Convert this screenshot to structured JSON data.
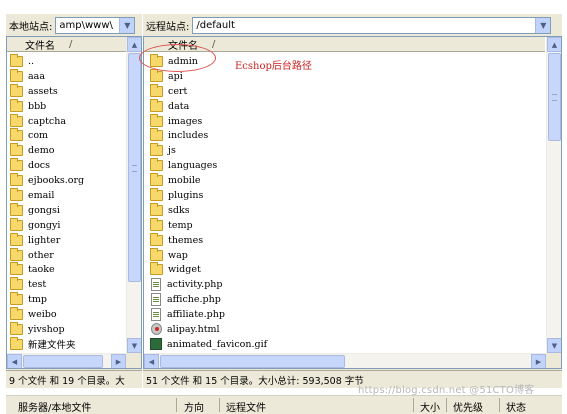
{
  "local": {
    "site_label": "本地站点:",
    "path_value": "amp\\www\\",
    "column_name": "文件名",
    "sort_indicator": "/",
    "items": [
      {
        "name": "..",
        "type": "folder"
      },
      {
        "name": "aaa",
        "type": "folder"
      },
      {
        "name": "assets",
        "type": "folder"
      },
      {
        "name": "bbb",
        "type": "folder"
      },
      {
        "name": "captcha",
        "type": "folder"
      },
      {
        "name": "com",
        "type": "folder"
      },
      {
        "name": "demo",
        "type": "folder"
      },
      {
        "name": "docs",
        "type": "folder"
      },
      {
        "name": "ejbooks.org",
        "type": "folder"
      },
      {
        "name": "email",
        "type": "folder"
      },
      {
        "name": "gongsi",
        "type": "folder"
      },
      {
        "name": "gongyi",
        "type": "folder"
      },
      {
        "name": "lighter",
        "type": "folder"
      },
      {
        "name": "other",
        "type": "folder"
      },
      {
        "name": "taoke",
        "type": "folder"
      },
      {
        "name": "test",
        "type": "folder"
      },
      {
        "name": "tmp",
        "type": "folder"
      },
      {
        "name": "weibo",
        "type": "folder"
      },
      {
        "name": "yivshop",
        "type": "folder"
      },
      {
        "name": "新建文件夹",
        "type": "folder"
      }
    ],
    "status": "9 个文件 和 19 个目录。大"
  },
  "remote": {
    "site_label": "远程站点:",
    "path_value": "/default",
    "column_name": "文件名",
    "sort_indicator": "/",
    "items": [
      {
        "name": "admin",
        "type": "folder"
      },
      {
        "name": "api",
        "type": "folder"
      },
      {
        "name": "cert",
        "type": "folder"
      },
      {
        "name": "data",
        "type": "folder"
      },
      {
        "name": "images",
        "type": "folder"
      },
      {
        "name": "includes",
        "type": "folder"
      },
      {
        "name": "js",
        "type": "folder"
      },
      {
        "name": "languages",
        "type": "folder"
      },
      {
        "name": "mobile",
        "type": "folder"
      },
      {
        "name": "plugins",
        "type": "folder"
      },
      {
        "name": "sdks",
        "type": "folder"
      },
      {
        "name": "temp",
        "type": "folder"
      },
      {
        "name": "themes",
        "type": "folder"
      },
      {
        "name": "wap",
        "type": "folder"
      },
      {
        "name": "widget",
        "type": "folder"
      },
      {
        "name": "activity.php",
        "type": "file"
      },
      {
        "name": "affiche.php",
        "type": "file"
      },
      {
        "name": "affiliate.php",
        "type": "file"
      },
      {
        "name": "alipay.html",
        "type": "html"
      },
      {
        "name": "animated_favicon.gif",
        "type": "gif"
      }
    ],
    "status": "51 个文件 和 15 个目录。大小总计: 593,508 字节"
  },
  "annotation": {
    "text": "Ecshop后台路径"
  },
  "queue": {
    "col_server": "服务器/本地文件",
    "col_direction": "方向",
    "col_remote": "远程文件",
    "col_size": "大小",
    "col_priority": "优先级",
    "col_status": "状态"
  },
  "watermark": "https://blog.csdn.net @51CTO博客",
  "icons": {
    "folder": "folder-icon",
    "file": "php-file-icon",
    "html": "html-file-icon",
    "gif": "gif-file-icon",
    "combo": "chevron-down-icon"
  },
  "colors": {
    "accent": "#c1d3fb",
    "window_bg": "#ece9d8",
    "annotation": "#cc2020",
    "folder": "#f7d86b"
  }
}
